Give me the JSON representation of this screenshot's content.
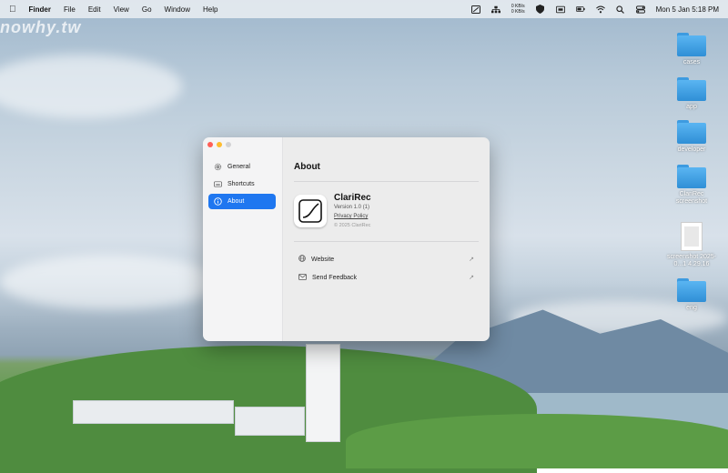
{
  "watermark": "nowhy.tw",
  "menubar": {
    "app_name": "Finder",
    "menus": [
      "File",
      "Edit",
      "View",
      "Go",
      "Window",
      "Help"
    ],
    "net_up": "0 KB/s",
    "net_down": "0 KB/s",
    "datetime": "Mon 5 Jan  5:18 PM",
    "icons": [
      "note-icon",
      "network-icon",
      "shield-icon",
      "keyboard-icon",
      "battery-icon",
      "wifi-icon",
      "search-icon",
      "control-center-icon"
    ]
  },
  "desktop_items": [
    {
      "label": "cases",
      "kind": "folder"
    },
    {
      "label": "app",
      "kind": "folder"
    },
    {
      "label": "developer",
      "kind": "folder"
    },
    {
      "label": "ClariRec screenshot",
      "kind": "folder"
    },
    {
      "label": "screenshot 2025-0...1 4.29.16",
      "kind": "file"
    },
    {
      "label": "eng",
      "kind": "folder"
    }
  ],
  "sidebar": {
    "items": [
      {
        "label": "General",
        "icon": "gear-icon"
      },
      {
        "label": "Shortcuts",
        "icon": "keyboard-icon"
      },
      {
        "label": "About",
        "icon": "info-icon"
      }
    ],
    "active": "About"
  },
  "about": {
    "heading": "About",
    "app_name": "ClariRec",
    "version": "Version 1.0 (1)",
    "privacy": "Privacy Policy",
    "copyright": "© 2025 ClariRec",
    "links": [
      {
        "label": "Website",
        "icon": "globe-icon"
      },
      {
        "label": "Send Feedback",
        "icon": "envelope-icon"
      }
    ]
  },
  "colors": {
    "accent": "#1f77f0",
    "folder": "#3fa0e6"
  }
}
